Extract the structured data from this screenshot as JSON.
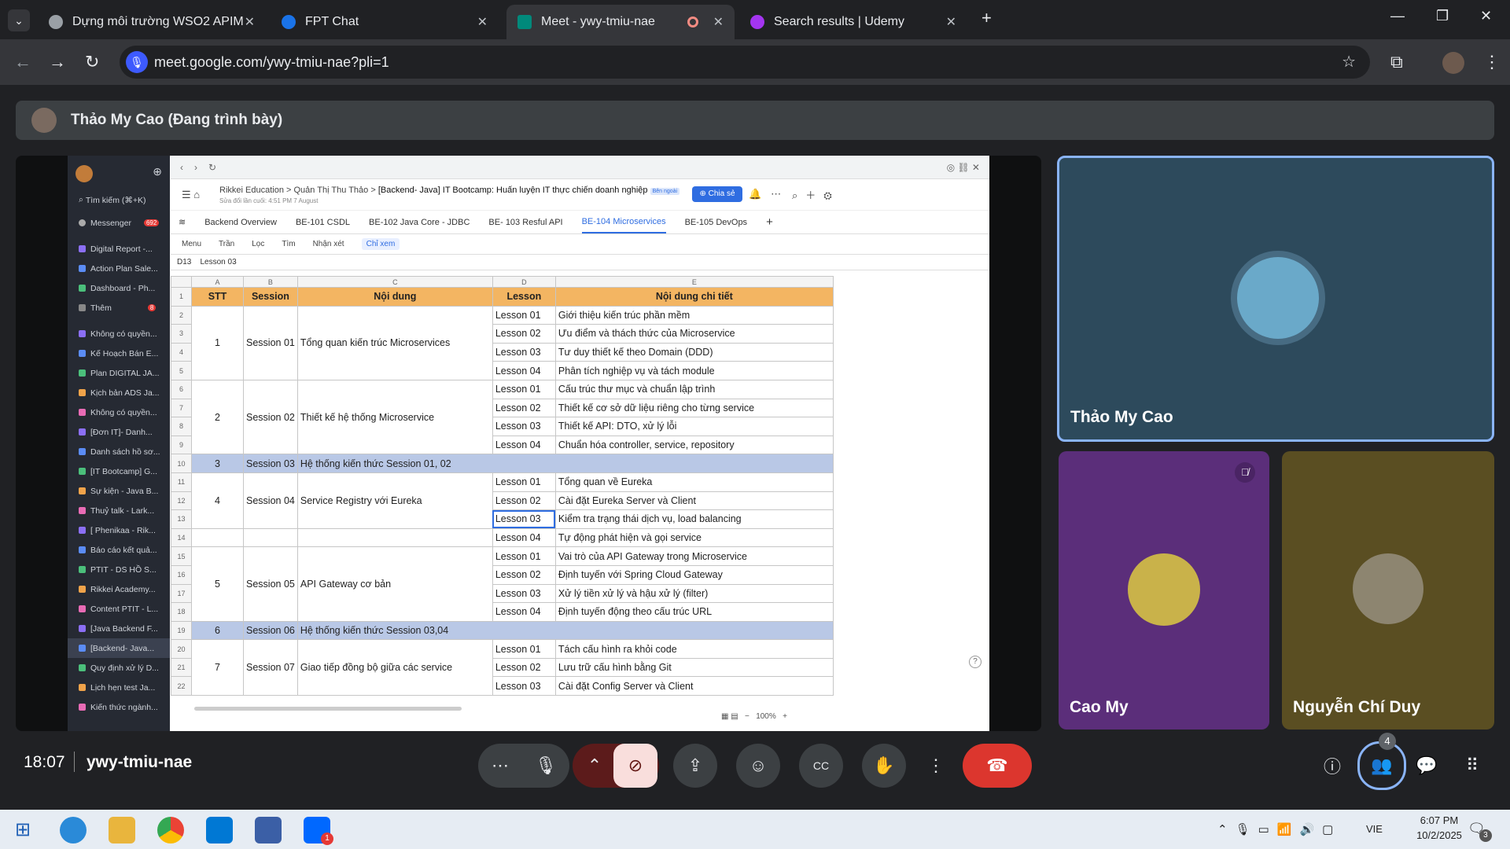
{
  "browser": {
    "tabs": [
      {
        "title": "Dựng môi trường WSO2 APIM",
        "color": "#9aa0a6"
      },
      {
        "title": "FPT Chat",
        "color": "#1a73e8"
      },
      {
        "title": "Meet - ywy-tmiu-nae",
        "color": "#00897b"
      },
      {
        "title": "Search results | Udemy",
        "color": "#a435f0"
      }
    ],
    "url": "meet.google.com/ywy-tmiu-nae?pli=1"
  },
  "presenter_bar": "Thảo My Cao (Đang trình bày)",
  "shared": {
    "sidebar": {
      "search": "Tìm kiếm (⌘+K)",
      "messenger": "Messenger",
      "messenger_badge": "692",
      "items1": [
        "Digital Report -...",
        "Action Plan Sale...",
        "Dashboard - Ph..."
      ],
      "more": "Thêm",
      "more_badge": "8",
      "items2": [
        "Không có quyền...",
        "Kế Hoạch Bán E...",
        "Plan DIGITAL JA...",
        "Kịch bản ADS Ja...",
        "Không có quyền...",
        "[Đơn IT]- Danh...",
        "Danh sách hồ sơ...",
        "[IT Bootcamp] G...",
        "Sự kiện - Java B...",
        "Thuỷ talk - Lark...",
        "[ Phenikaa - Rik...",
        "Báo cáo kết quả...",
        "PTIT - DS HỒ S...",
        "Rikkei Academy...",
        "Content PTIT - L...",
        "[Java Backend F...",
        "[Backend- Java...",
        "Quy định xử lý D...",
        "Lịch hẹn test Ja...",
        "Kiến thức ngành..."
      ]
    },
    "breadcrumb": [
      "Rikkei Education",
      "Quản Thị Thu Thảo",
      "[Backend- Java] IT Bootcamp: Huấn luyện IT thực chiến doanh nghiệp"
    ],
    "external_badge": "Bên ngoài",
    "last_edit": "Sửa đổi lần cuối: 4:51 PM 7 August",
    "share_btn": "Chia sẻ",
    "tabs": [
      "Backend Overview",
      "BE-101 CSDL",
      "BE-102 Java Core - JDBC",
      "BE- 103 Resful API",
      "BE-104 Microservices",
      "BE-105 DevOps"
    ],
    "toolbar": [
      "Menu",
      "Trần",
      "Lọc",
      "Tìm",
      "Nhận xét",
      "Chỉ xem"
    ],
    "cell_ref": "D13",
    "cell_val": "Lesson 03",
    "cols": [
      "A",
      "B",
      "C",
      "D",
      "E"
    ],
    "header": [
      "STT",
      "Session",
      "Nội dung",
      "Lesson",
      "Nội dung chi tiết"
    ],
    "rows": [
      {
        "r": "2",
        "stt": "1",
        "session": "Session 01",
        "content": "Tổng quan kiến trúc Microservices",
        "lesson": "Lesson 01",
        "detail": "Giới thiệu kiến trúc phần mềm"
      },
      {
        "r": "3",
        "lesson": "Lesson 02",
        "detail": "Ưu điểm và thách thức của Microservice"
      },
      {
        "r": "4",
        "lesson": "Lesson 03",
        "detail": "Tư duy thiết kế theo Domain (DDD)"
      },
      {
        "r": "5",
        "lesson": "Lesson 04",
        "detail": "Phân tích nghiệp vụ và tách module"
      },
      {
        "r": "6",
        "stt": "2",
        "session": "Session 02",
        "content": "Thiết kế hệ thống Microservice",
        "lesson": "Lesson 01",
        "detail": "Cấu trúc thư mục và chuẩn lập trình"
      },
      {
        "r": "7",
        "lesson": "Lesson 02",
        "detail": "Thiết kế cơ sở dữ liệu riêng cho từng service"
      },
      {
        "r": "8",
        "lesson": "Lesson 03",
        "detail": "Thiết kế API: DTO, xử lý lỗi"
      },
      {
        "r": "9",
        "lesson": "Lesson 04",
        "detail": "Chuẩn hóa controller, service, repository"
      },
      {
        "r": "10",
        "sum": true,
        "stt": "3",
        "session": "Session 03",
        "content": "Hệ thống kiến thức Session 01, 02"
      },
      {
        "r": "11",
        "stt": "4",
        "session": "Session 04",
        "content": "Service Registry với Eureka",
        "lesson": "Lesson 01",
        "detail": "Tổng quan về Eureka"
      },
      {
        "r": "12",
        "lesson": "Lesson 02",
        "detail": " Cài đặt Eureka Server và Client"
      },
      {
        "r": "13",
        "lesson": "Lesson 03",
        "detail": " Kiểm tra trạng thái dịch vụ, load balancing",
        "sel": true
      },
      {
        "r": "14",
        "lesson": "Lesson 04",
        "detail": "Tự động phát hiện và gọi service"
      },
      {
        "r": "15",
        "stt": "5",
        "session": "Session 05",
        "content": "API Gateway cơ bản",
        "lesson": "Lesson 01",
        "detail": " Vai trò của API Gateway trong Microservice"
      },
      {
        "r": "16",
        "lesson": "Lesson 02",
        "detail": " Định tuyến với Spring Cloud Gateway"
      },
      {
        "r": "17",
        "lesson": "Lesson 03",
        "detail": "Xử lý tiền xử lý và hậu xử lý (filter)"
      },
      {
        "r": "18",
        "lesson": "Lesson 04",
        "detail": " Định tuyến động theo cấu trúc URL"
      },
      {
        "r": "19",
        "sum": true,
        "stt": "6",
        "session": "Session 06",
        "content": "Hệ thống kiến thức Session 03,04"
      },
      {
        "r": "20",
        "stt": "7",
        "session": "Session 07",
        "content": "Giao tiếp đồng bộ giữa các service",
        "lesson": "Lesson 01",
        "detail": "Tách cấu hình ra khỏi code"
      },
      {
        "r": "21",
        "lesson": "Lesson 02",
        "detail": "Lưu trữ cấu hình bằng Git"
      },
      {
        "r": "22",
        "lesson": "Lesson 03",
        "detail": "Cài đặt Config Server và Client"
      }
    ],
    "zoom": "100%"
  },
  "participants": [
    {
      "name": "Thảo My Cao",
      "bg": "#2d4a5c"
    },
    {
      "name": "Cao My",
      "bg": "#5b2e7a"
    },
    {
      "name": "Nguyễn Chí Duy",
      "bg": "#5a4e22"
    }
  ],
  "meeting": {
    "time": "18:07",
    "code": "ywy-tmiu-nae",
    "people_count": "4"
  },
  "system": {
    "lang": "VIE",
    "time": "6:07 PM",
    "date": "10/2/2025",
    "notif": "3",
    "zalo_badge": "1"
  }
}
